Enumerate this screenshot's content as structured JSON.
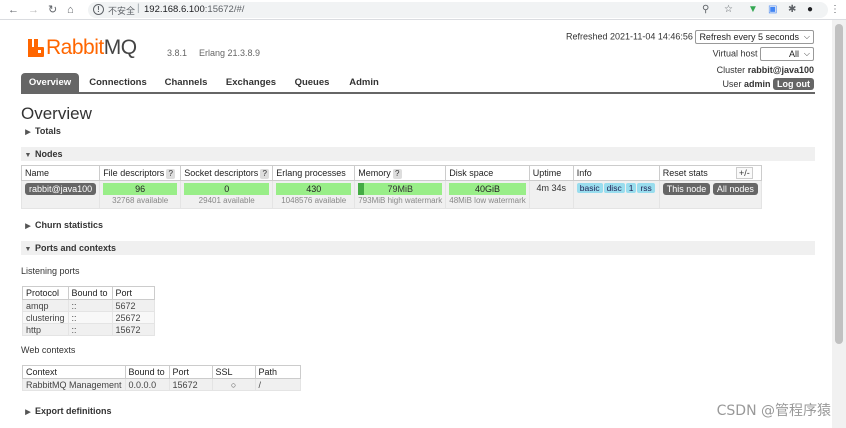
{
  "browser": {
    "back_icon": "back-arrow-icon",
    "forward_icon": "forward-arrow-icon",
    "reload_icon": "reload-icon",
    "home_icon": "home-icon",
    "insecure_label": "不安全",
    "url_host": "192.168.6.100",
    "url_rest": ":15672/#/"
  },
  "header": {
    "logo_rabbit": "Rabbit",
    "logo_mq": "MQ",
    "version": "3.8.1",
    "erlang": "Erlang 21.3.8.9",
    "refreshed": "Refreshed 2021-11-04 14:46:56",
    "refresh_select": "Refresh every 5 seconds",
    "vhost_label": "Virtual host",
    "vhost_select": "All",
    "cluster_label": "Cluster",
    "cluster_name": "rabbit@java100",
    "user_label": "User",
    "user_name": "admin",
    "logout": "Log out"
  },
  "tabs": [
    {
      "label": "Overview",
      "active": true
    },
    {
      "label": "Connections"
    },
    {
      "label": "Channels"
    },
    {
      "label": "Exchanges"
    },
    {
      "label": "Queues"
    },
    {
      "label": "Admin"
    }
  ],
  "page_title": "Overview",
  "sections": {
    "totals": "Totals",
    "nodes": "Nodes",
    "churn": "Churn statistics",
    "ports": "Ports and contexts",
    "export": "Export definitions"
  },
  "nodes_table": {
    "headers": {
      "name": "Name",
      "fd": "File descriptors",
      "sockets": "Socket descriptors",
      "erlang": "Erlang processes",
      "memory": "Memory",
      "disk": "Disk space",
      "uptime": "Uptime",
      "info": "Info",
      "reset": "Reset stats"
    },
    "help_mark": "?",
    "plus_minus": "+/-",
    "row": {
      "name": "rabbit@java100",
      "fd_used": "96",
      "fd_avail": "32768 available",
      "sockets_used": "0",
      "sockets_avail": "29401 available",
      "erlang_used": "430",
      "erlang_avail": "1048576 available",
      "memory_used": "79MiB",
      "memory_watermark": "793MiB high watermark",
      "disk_free": "40GiB",
      "disk_watermark": "48MiB low watermark",
      "uptime": "4m 34s",
      "info": [
        "basic",
        "disc",
        "1",
        "rss"
      ],
      "reset_this": "This node",
      "reset_all": "All nodes"
    }
  },
  "listening_ports": {
    "caption": "Listening ports",
    "headers": [
      "Protocol",
      "Bound to",
      "Port"
    ],
    "rows": [
      [
        "amqp",
        "::",
        "5672"
      ],
      [
        "clustering",
        "::",
        "25672"
      ],
      [
        "http",
        "::",
        "15672"
      ]
    ]
  },
  "web_contexts": {
    "caption": "Web contexts",
    "headers": [
      "Context",
      "Bound to",
      "Port",
      "SSL",
      "Path"
    ],
    "rows": [
      [
        "RabbitMQ Management",
        "0.0.0.0",
        "15672",
        "○",
        "/"
      ]
    ]
  },
  "watermark": "CSDN @管程序猿",
  "colors": {
    "brand_orange": "#ff6600",
    "tab_active": "#666666",
    "bar_green": "#99ee88",
    "info_blue": "#99ddee"
  }
}
